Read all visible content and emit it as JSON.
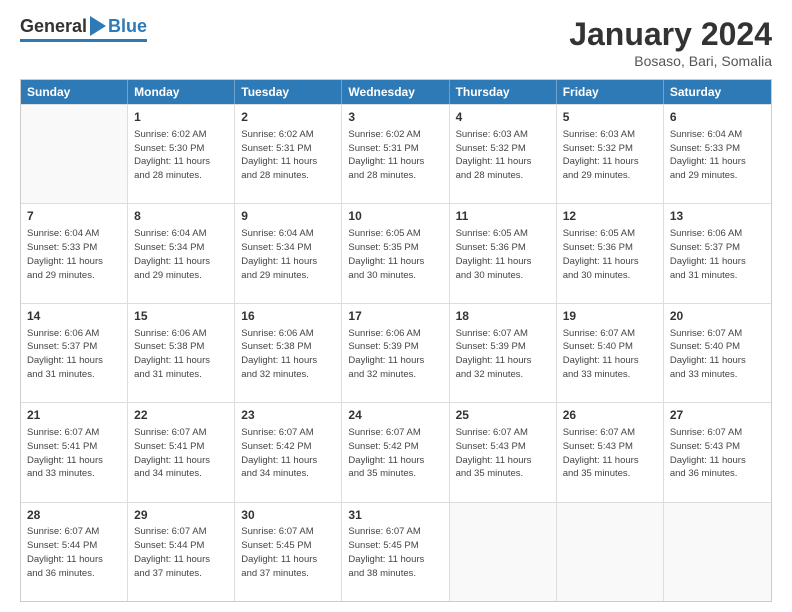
{
  "logo": {
    "general": "General",
    "blue": "Blue"
  },
  "title": "January 2024",
  "subtitle": "Bosaso, Bari, Somalia",
  "header": {
    "days": [
      "Sunday",
      "Monday",
      "Tuesday",
      "Wednesday",
      "Thursday",
      "Friday",
      "Saturday"
    ]
  },
  "rows": [
    [
      {
        "day": "",
        "info": ""
      },
      {
        "day": "1",
        "info": "Sunrise: 6:02 AM\nSunset: 5:30 PM\nDaylight: 11 hours\nand 28 minutes."
      },
      {
        "day": "2",
        "info": "Sunrise: 6:02 AM\nSunset: 5:31 PM\nDaylight: 11 hours\nand 28 minutes."
      },
      {
        "day": "3",
        "info": "Sunrise: 6:02 AM\nSunset: 5:31 PM\nDaylight: 11 hours\nand 28 minutes."
      },
      {
        "day": "4",
        "info": "Sunrise: 6:03 AM\nSunset: 5:32 PM\nDaylight: 11 hours\nand 28 minutes."
      },
      {
        "day": "5",
        "info": "Sunrise: 6:03 AM\nSunset: 5:32 PM\nDaylight: 11 hours\nand 29 minutes."
      },
      {
        "day": "6",
        "info": "Sunrise: 6:04 AM\nSunset: 5:33 PM\nDaylight: 11 hours\nand 29 minutes."
      }
    ],
    [
      {
        "day": "7",
        "info": "Sunrise: 6:04 AM\nSunset: 5:33 PM\nDaylight: 11 hours\nand 29 minutes."
      },
      {
        "day": "8",
        "info": "Sunrise: 6:04 AM\nSunset: 5:34 PM\nDaylight: 11 hours\nand 29 minutes."
      },
      {
        "day": "9",
        "info": "Sunrise: 6:04 AM\nSunset: 5:34 PM\nDaylight: 11 hours\nand 29 minutes."
      },
      {
        "day": "10",
        "info": "Sunrise: 6:05 AM\nSunset: 5:35 PM\nDaylight: 11 hours\nand 30 minutes."
      },
      {
        "day": "11",
        "info": "Sunrise: 6:05 AM\nSunset: 5:36 PM\nDaylight: 11 hours\nand 30 minutes."
      },
      {
        "day": "12",
        "info": "Sunrise: 6:05 AM\nSunset: 5:36 PM\nDaylight: 11 hours\nand 30 minutes."
      },
      {
        "day": "13",
        "info": "Sunrise: 6:06 AM\nSunset: 5:37 PM\nDaylight: 11 hours\nand 31 minutes."
      }
    ],
    [
      {
        "day": "14",
        "info": "Sunrise: 6:06 AM\nSunset: 5:37 PM\nDaylight: 11 hours\nand 31 minutes."
      },
      {
        "day": "15",
        "info": "Sunrise: 6:06 AM\nSunset: 5:38 PM\nDaylight: 11 hours\nand 31 minutes."
      },
      {
        "day": "16",
        "info": "Sunrise: 6:06 AM\nSunset: 5:38 PM\nDaylight: 11 hours\nand 32 minutes."
      },
      {
        "day": "17",
        "info": "Sunrise: 6:06 AM\nSunset: 5:39 PM\nDaylight: 11 hours\nand 32 minutes."
      },
      {
        "day": "18",
        "info": "Sunrise: 6:07 AM\nSunset: 5:39 PM\nDaylight: 11 hours\nand 32 minutes."
      },
      {
        "day": "19",
        "info": "Sunrise: 6:07 AM\nSunset: 5:40 PM\nDaylight: 11 hours\nand 33 minutes."
      },
      {
        "day": "20",
        "info": "Sunrise: 6:07 AM\nSunset: 5:40 PM\nDaylight: 11 hours\nand 33 minutes."
      }
    ],
    [
      {
        "day": "21",
        "info": "Sunrise: 6:07 AM\nSunset: 5:41 PM\nDaylight: 11 hours\nand 33 minutes."
      },
      {
        "day": "22",
        "info": "Sunrise: 6:07 AM\nSunset: 5:41 PM\nDaylight: 11 hours\nand 34 minutes."
      },
      {
        "day": "23",
        "info": "Sunrise: 6:07 AM\nSunset: 5:42 PM\nDaylight: 11 hours\nand 34 minutes."
      },
      {
        "day": "24",
        "info": "Sunrise: 6:07 AM\nSunset: 5:42 PM\nDaylight: 11 hours\nand 35 minutes."
      },
      {
        "day": "25",
        "info": "Sunrise: 6:07 AM\nSunset: 5:43 PM\nDaylight: 11 hours\nand 35 minutes."
      },
      {
        "day": "26",
        "info": "Sunrise: 6:07 AM\nSunset: 5:43 PM\nDaylight: 11 hours\nand 35 minutes."
      },
      {
        "day": "27",
        "info": "Sunrise: 6:07 AM\nSunset: 5:43 PM\nDaylight: 11 hours\nand 36 minutes."
      }
    ],
    [
      {
        "day": "28",
        "info": "Sunrise: 6:07 AM\nSunset: 5:44 PM\nDaylight: 11 hours\nand 36 minutes."
      },
      {
        "day": "29",
        "info": "Sunrise: 6:07 AM\nSunset: 5:44 PM\nDaylight: 11 hours\nand 37 minutes."
      },
      {
        "day": "30",
        "info": "Sunrise: 6:07 AM\nSunset: 5:45 PM\nDaylight: 11 hours\nand 37 minutes."
      },
      {
        "day": "31",
        "info": "Sunrise: 6:07 AM\nSunset: 5:45 PM\nDaylight: 11 hours\nand 38 minutes."
      },
      {
        "day": "",
        "info": ""
      },
      {
        "day": "",
        "info": ""
      },
      {
        "day": "",
        "info": ""
      }
    ]
  ]
}
